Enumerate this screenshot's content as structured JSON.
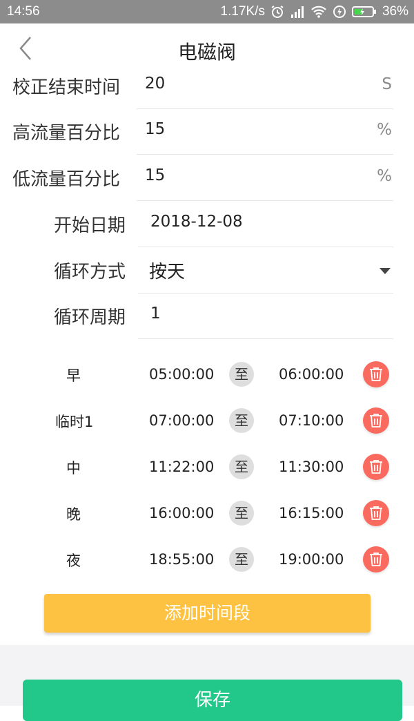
{
  "status_bar": {
    "time": "14:56",
    "net_speed": "1.17K/s",
    "battery": "36%",
    "icons": [
      "alarm-icon",
      "signal-icon",
      "wifi-icon",
      "charging-icon",
      "battery-icon"
    ]
  },
  "header": {
    "title": "电磁阀"
  },
  "form": {
    "calib_end": {
      "label": "校正结束时间",
      "value": "20",
      "unit": "S"
    },
    "high_flow": {
      "label": "高流量百分比",
      "value": "15",
      "unit": "%"
    },
    "low_flow": {
      "label": "低流量百分比",
      "value": "15",
      "unit": "%"
    },
    "start_date": {
      "label": "开始日期",
      "value": "2018-12-08"
    },
    "cycle_mode": {
      "label": "循环方式",
      "value": "按天"
    },
    "cycle_period": {
      "label": "循环周期",
      "value": "1"
    }
  },
  "slots": [
    {
      "name": "早",
      "start": "05:00:00",
      "sep": "至",
      "end": "06:00:00"
    },
    {
      "name": "临时1",
      "start": "07:00:00",
      "sep": "至",
      "end": "07:10:00"
    },
    {
      "name": "中",
      "start": "11:22:00",
      "sep": "至",
      "end": "11:30:00"
    },
    {
      "name": "晚",
      "start": "16:00:00",
      "sep": "至",
      "end": "16:15:00"
    },
    {
      "name": "夜",
      "start": "18:55:00",
      "sep": "至",
      "end": "19:00:00"
    }
  ],
  "actions": {
    "add_label": "添加时间段",
    "save_label": "保存"
  },
  "colors": {
    "status_bar": "#8c8c8c",
    "add_button": "#fdc241",
    "save_button": "#22c88a",
    "delete_button": "#fb6a5e",
    "separator_chip": "#dedede"
  }
}
